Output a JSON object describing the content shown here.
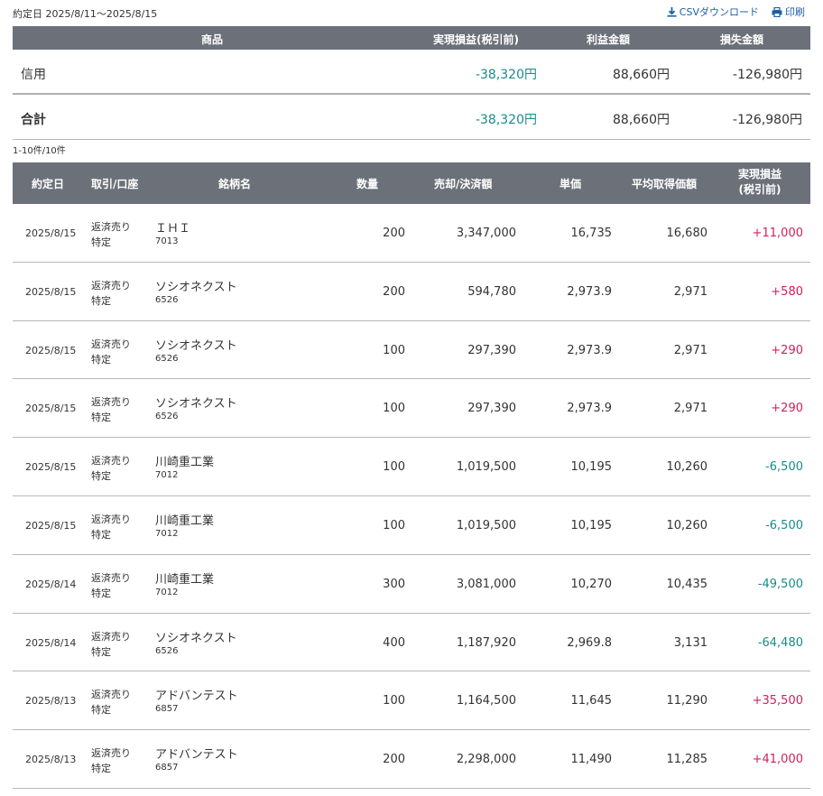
{
  "period": "約定日 2025/8/11～2025/8/15",
  "actions": {
    "csv": "CSVダウンロード",
    "print": "印刷"
  },
  "summary": {
    "headers": {
      "product": "商品",
      "realized": "実現損益(税引前)",
      "profit": "利益金額",
      "loss": "損失金額"
    },
    "rows": [
      {
        "label": "信用",
        "realized": "-38,320円",
        "profit": "88,660円",
        "loss": "-126,980円"
      },
      {
        "label": "合計",
        "realized": "-38,320円",
        "profit": "88,660円",
        "loss": "-126,980円"
      }
    ]
  },
  "count": "1-10件/10件",
  "detail": {
    "headers": {
      "date": "約定日",
      "type": "取引/口座",
      "name": "銘柄名",
      "qty": "数量",
      "amount": "売却/決済額",
      "price": "単価",
      "avg": "平均取得価額",
      "pl_line1": "実現損益",
      "pl_line2": "(税引前)"
    },
    "rows": [
      {
        "date": "2025/8/15",
        "type": "返済売り",
        "account": "特定",
        "name": "ＩＨＩ",
        "code": "7013",
        "qty": "200",
        "amount": "3,347,000",
        "price": "16,735",
        "avg": "16,680",
        "pl": "+11,000"
      },
      {
        "date": "2025/8/15",
        "type": "返済売り",
        "account": "特定",
        "name": "ソシオネクスト",
        "code": "6526",
        "qty": "200",
        "amount": "594,780",
        "price": "2,973.9",
        "avg": "2,971",
        "pl": "+580"
      },
      {
        "date": "2025/8/15",
        "type": "返済売り",
        "account": "特定",
        "name": "ソシオネクスト",
        "code": "6526",
        "qty": "100",
        "amount": "297,390",
        "price": "2,973.9",
        "avg": "2,971",
        "pl": "+290"
      },
      {
        "date": "2025/8/15",
        "type": "返済売り",
        "account": "特定",
        "name": "ソシオネクスト",
        "code": "6526",
        "qty": "100",
        "amount": "297,390",
        "price": "2,973.9",
        "avg": "2,971",
        "pl": "+290"
      },
      {
        "date": "2025/8/15",
        "type": "返済売り",
        "account": "特定",
        "name": "川崎重工業",
        "code": "7012",
        "qty": "100",
        "amount": "1,019,500",
        "price": "10,195",
        "avg": "10,260",
        "pl": "-6,500"
      },
      {
        "date": "2025/8/15",
        "type": "返済売り",
        "account": "特定",
        "name": "川崎重工業",
        "code": "7012",
        "qty": "100",
        "amount": "1,019,500",
        "price": "10,195",
        "avg": "10,260",
        "pl": "-6,500"
      },
      {
        "date": "2025/8/14",
        "type": "返済売り",
        "account": "特定",
        "name": "川崎重工業",
        "code": "7012",
        "qty": "300",
        "amount": "3,081,000",
        "price": "10,270",
        "avg": "10,435",
        "pl": "-49,500"
      },
      {
        "date": "2025/8/14",
        "type": "返済売り",
        "account": "特定",
        "name": "ソシオネクスト",
        "code": "6526",
        "qty": "400",
        "amount": "1,187,920",
        "price": "2,969.8",
        "avg": "3,131",
        "pl": "-64,480"
      },
      {
        "date": "2025/8/13",
        "type": "返済売り",
        "account": "特定",
        "name": "アドバンテスト",
        "code": "6857",
        "qty": "100",
        "amount": "1,164,500",
        "price": "11,645",
        "avg": "11,290",
        "pl": "+35,500"
      },
      {
        "date": "2025/8/13",
        "type": "返済売り",
        "account": "特定",
        "name": "アドバンテスト",
        "code": "6857",
        "qty": "200",
        "amount": "2,298,000",
        "price": "11,490",
        "avg": "11,285",
        "pl": "+41,000"
      }
    ]
  },
  "colors": {
    "header_bg": "#6b7079",
    "positive": "#d11f5e",
    "negative": "#1b8a8a",
    "link": "#1f5fa8"
  }
}
